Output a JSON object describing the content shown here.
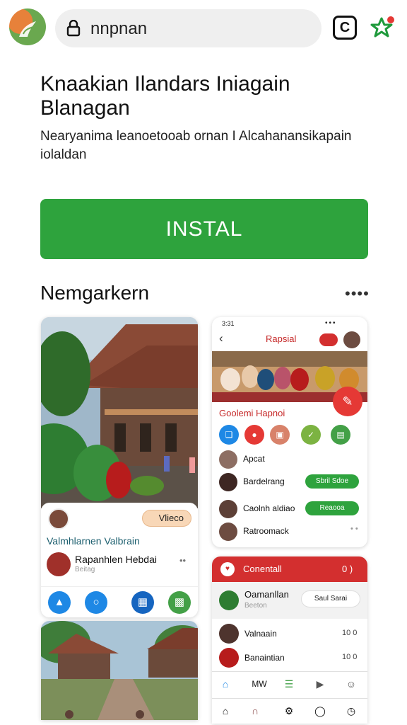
{
  "browser": {
    "url": "nnpnan",
    "tabs_icon": "tabs-icon",
    "lock_icon": "lock-icon",
    "extension_icon": "star-icon"
  },
  "app": {
    "title": "Knaakian Ilandars Iniagain Blanagan",
    "description": "Nearyanima leanoetooab ornan I Alcahanansikapain iolaldan",
    "install_label": "INSTAL",
    "section_title": "Nemgarkern",
    "more_label": "••••"
  },
  "screen1": {
    "pill_label": "Vlieco",
    "title": "Valmhlarnen Valbrain",
    "name": "Rapanhlen Hebdai",
    "sub": "Beitag",
    "menu": "••",
    "icons": [
      "share-icon",
      "chat-icon",
      "grid-icon",
      "calendar-icon"
    ]
  },
  "screen2": {
    "time": "3:31",
    "title": "Rapsial",
    "section": "Goolemi Hapnoi",
    "items": [
      {
        "name": "Apcat",
        "button": ""
      },
      {
        "name": "Bardelrang",
        "button": "Sbril Sdoe"
      },
      {
        "name": "Caolnh aldiao",
        "button": "Reaooa"
      },
      {
        "name": "Ratroomack",
        "button": ""
      }
    ],
    "menu": "• •"
  },
  "screen3": {
    "header": "Conentall",
    "header_right": "0 )",
    "featured_name": "Oamanllan",
    "featured_sub": "Beeton",
    "featured_pill": "Saul Sarai",
    "rows": [
      {
        "name": "Valnaain",
        "right": "10 0"
      },
      {
        "name": "Banaintian",
        "right": "10 0"
      }
    ],
    "tab_label": "MW"
  },
  "colors": {
    "install_green": "#2ea33d",
    "accent_red": "#d32f2f"
  }
}
